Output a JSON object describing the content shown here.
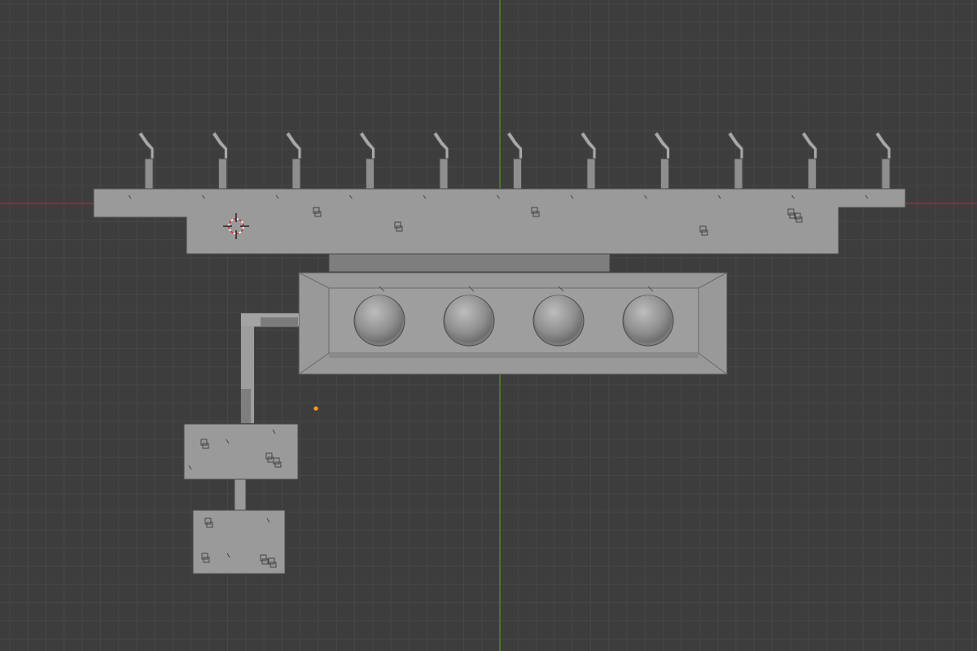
{
  "viewport": {
    "background": "#3d3d3d",
    "grid_color": "#474747",
    "x_axis_color": "#8f3c3c",
    "y_axis_color": "#5e8f24"
  },
  "scene": {
    "mesh_color": "#9a9a9a",
    "mesh_dark_color": "#7c7c7c",
    "mesh_edge_color": "#3f3f3f",
    "origin_color": "#ff9a1f",
    "cursor_color": "#d33030"
  },
  "objects": {
    "fountain_count": 11,
    "basin_count": 4
  }
}
